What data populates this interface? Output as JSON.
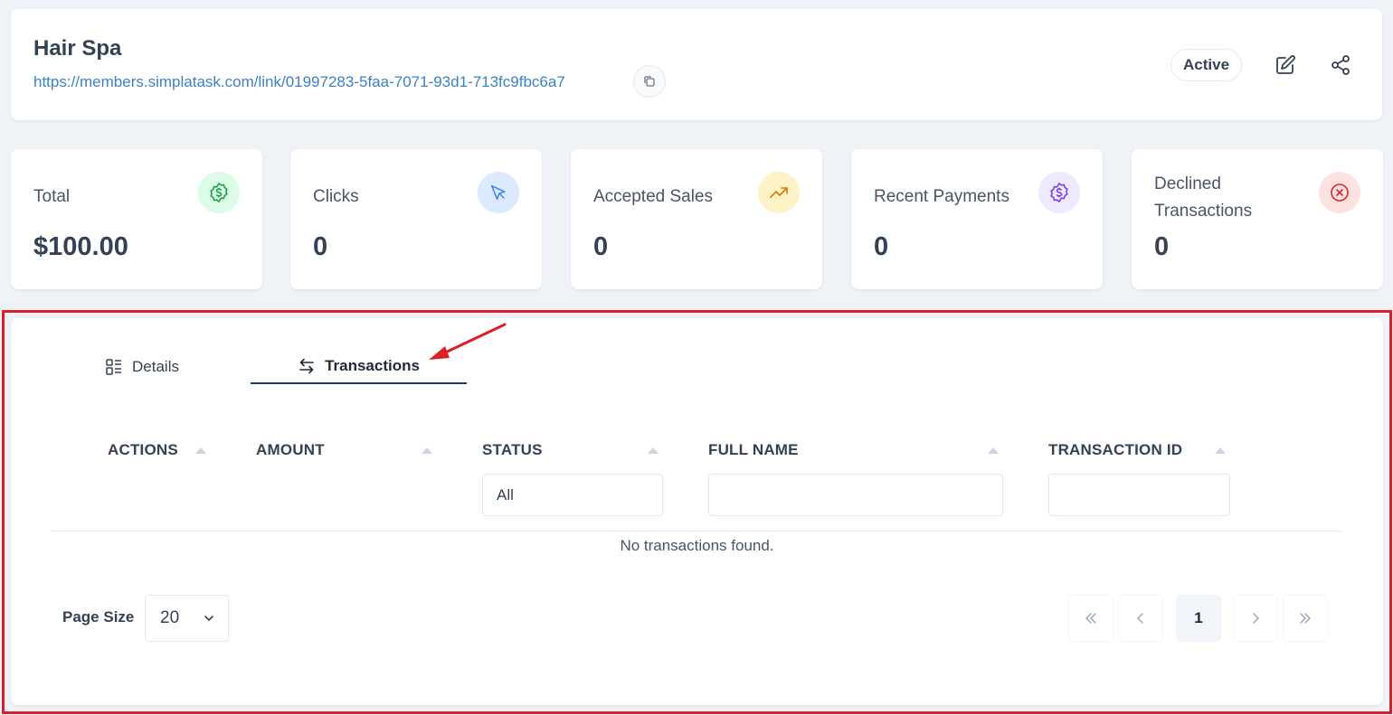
{
  "header": {
    "title": "Hair Spa",
    "link": "https://members.simplatask.com/link/01997283-5faa-7071-93d1-713fc9fbc6a7",
    "status": "Active"
  },
  "stats": [
    {
      "label": "Total",
      "value": "$100.00",
      "icon": "dollar-badge-icon",
      "color": "#16a34a",
      "bg": "#dcfce7"
    },
    {
      "label": "Clicks",
      "value": "0",
      "icon": "cursor-icon",
      "color": "#3b82f6",
      "bg": "#dbeafe"
    },
    {
      "label": "Accepted Sales",
      "value": "0",
      "icon": "trending-up-icon",
      "color": "#d97706",
      "bg": "#fef3c7"
    },
    {
      "label": "Recent Payments",
      "value": "0",
      "icon": "dollar-badge-icon",
      "color": "#7c3aed",
      "bg": "#ede9fe"
    },
    {
      "label": "Declined Transactions",
      "value": "0",
      "icon": "x-circle-icon",
      "color": "#dc2626",
      "bg": "#fee2e2"
    }
  ],
  "tabs": [
    {
      "label": "Details",
      "active": false
    },
    {
      "label": "Transactions",
      "active": true
    }
  ],
  "table": {
    "columns": [
      "ACTIONS",
      "AMOUNT",
      "STATUS",
      "FULL NAME",
      "TRANSACTION ID"
    ],
    "status_filter": "All",
    "empty_message": "No transactions found."
  },
  "pagination": {
    "page_size_label": "Page Size",
    "page_size": "20",
    "current_page": "1",
    "first": "«",
    "prev": "‹",
    "next": "›",
    "last": "»"
  },
  "colors": {
    "highlight": "#d92027",
    "link": "#3b82c4",
    "tab_underline": "#1e3a6e"
  }
}
